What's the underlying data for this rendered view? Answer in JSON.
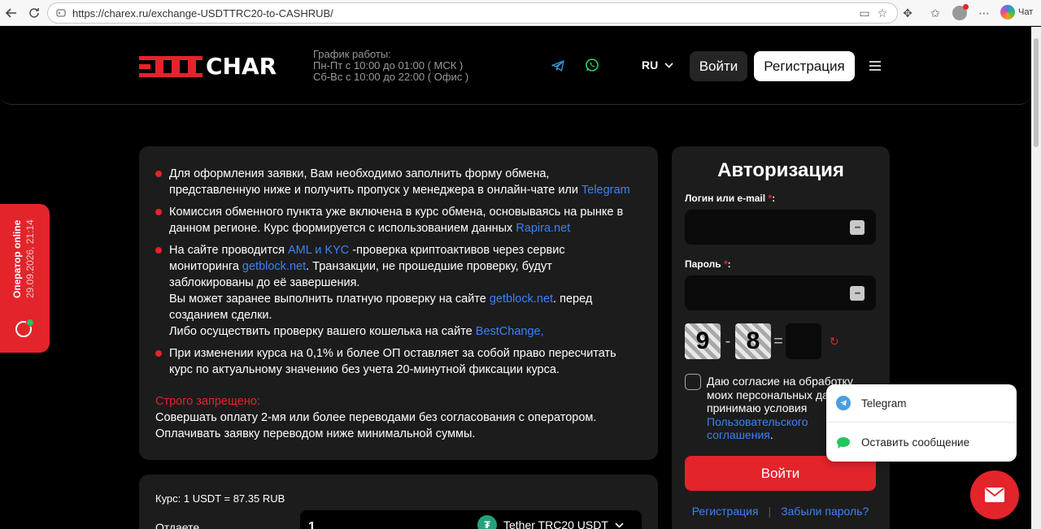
{
  "browser": {
    "url": "https://charex.ru/exchange-USDTTRC20-to-CASHRUB/",
    "copilot_label": "Чат"
  },
  "header": {
    "logo_text": "CHAR",
    "schedule": {
      "title": "График работы:",
      "line1": "Пн-Пт с 10:00 до 01:00 ( МСК )",
      "line2": "Сб-Вс с 10:00 до 22:00 ( Офис )"
    },
    "language": "RU",
    "login_label": "Войти",
    "register_label": "Регистрация"
  },
  "info": {
    "items": [
      {
        "text": "Для оформления заявки, Вам необходимо заполнить форму обмена, представленную ниже и получить пропуск у менеджера в онлайн-чате или ",
        "link": "Telegram"
      },
      {
        "text": "Комиссия обменного пункта уже включена в курс обмена, основываясь на рынке в данном регионе. Курс формируется с использованием данных ",
        "link": "Rapira.net"
      },
      {
        "pre": "На сайте проводится ",
        "link1": "AML и KYC",
        "mid": " -проверка криптоактивов через сервис мониторинга ",
        "link2": "getblock.net",
        "post": ". Транзакции, не прошедшие проверку, будут заблокированы до её завершения.",
        "line2_pre": "Вы может заранее выполнить платную проверку на сайте ",
        "line2_link": "getblock.net",
        "line2_post": ". перед созданием сделки.",
        "line3_pre": "Либо осуществить проверку вашего кошелька на сайте ",
        "line3_link": "BestChange,"
      },
      {
        "text": "При изменении курса на 0,1% и более ОП оставляет за собой право пересчитать курс по актуальному значению без учета 20-минутной фиксации курса."
      }
    ],
    "forbidden_title": "Строго запрещено:",
    "forbidden_line1": "Совершать оплату 2-мя или более переводами без согласования с оператором.",
    "forbidden_line2": "Оплачивать заявку переводом ниже минимальной суммы."
  },
  "rate": {
    "course": "Курс: 1 USDT = 87.35 RUB",
    "give_label": "Отдаете",
    "amount": "1",
    "currency": "Tether TRC20 USDT"
  },
  "auth": {
    "title": "Авторизация",
    "login_label": "Логин или e-mail ",
    "password_label": "Пароль ",
    "required_mark": "*",
    "colon": ":",
    "captcha_a": "9",
    "captcha_op": "-",
    "captcha_b": "8",
    "captcha_eq": "=",
    "agree_text": "Даю согласие на обработку моих персональных данных и принимаю условия ",
    "agree_link": "Пользовательского соглашения",
    "agree_end": ".",
    "submit": "Войти",
    "link_register": "Регистрация",
    "link_forgot": "Забыли пароль?"
  },
  "operator": {
    "status": "Оператор online",
    "datetime": "29.09.2026, 21:14"
  },
  "chat_popup": {
    "telegram": "Telegram",
    "message": "Оставить сообщение"
  },
  "colors": {
    "accent": "#e3242b",
    "link": "#3b82f6",
    "card": "#1c1c1c"
  }
}
